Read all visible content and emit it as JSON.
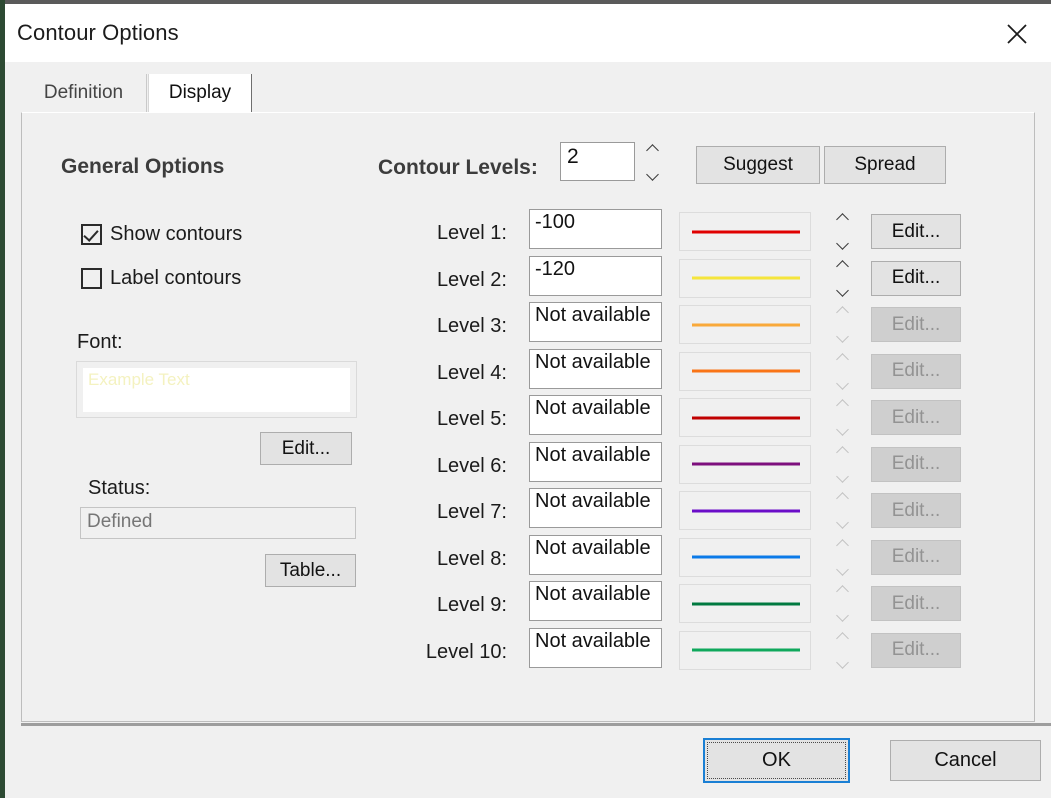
{
  "window": {
    "title": "Contour Options",
    "close_icon": "close-icon"
  },
  "tabs": [
    {
      "label": "Definition",
      "active": false
    },
    {
      "label": "Display",
      "active": true
    }
  ],
  "general_options": {
    "heading": "General Options",
    "checkboxes": [
      {
        "label": "Show contours",
        "checked": true
      },
      {
        "label": "Label contours",
        "checked": false
      }
    ],
    "font": {
      "label": "Font:",
      "preview_text": "Example Text",
      "preview_color": "#f4f2c0",
      "edit_label": "Edit..."
    },
    "status": {
      "label": "Status:",
      "value": "Defined",
      "table_label": "Table..."
    }
  },
  "contour_levels": {
    "label": "Contour Levels:",
    "count": "2",
    "suggest_label": "Suggest",
    "spread_label": "Spread",
    "edit_label": "Edit...",
    "rows": [
      {
        "label": "Level 1:",
        "value": "-100",
        "color": "#e00000",
        "enabled": true
      },
      {
        "label": "Level 2:",
        "value": "-120",
        "color": "#f5e53c",
        "enabled": true
      },
      {
        "label": "Level 3:",
        "value": "Not available",
        "color": "#f9a93a",
        "enabled": false
      },
      {
        "label": "Level 4:",
        "value": "Not available",
        "color": "#f97416",
        "enabled": false
      },
      {
        "label": "Level 5:",
        "value": "Not available",
        "color": "#c00000",
        "enabled": false
      },
      {
        "label": "Level 6:",
        "value": "Not available",
        "color": "#7d0f7d",
        "enabled": false
      },
      {
        "label": "Level 7:",
        "value": "Not available",
        "color": "#6a0dc8",
        "enabled": false
      },
      {
        "label": "Level 8:",
        "value": "Not available",
        "color": "#0b7ae8",
        "enabled": false
      },
      {
        "label": "Level 9:",
        "value": "Not available",
        "color": "#00793f",
        "enabled": false
      },
      {
        "label": "Level 10:",
        "value": "Not available",
        "color": "#0fa85c",
        "enabled": false
      }
    ]
  },
  "footer": {
    "ok_label": "OK",
    "cancel_label": "Cancel"
  },
  "colors": {
    "window_background": "#f0f0f0",
    "titlebar_background": "#ffffff",
    "focus_accent": "#1a7fd4"
  }
}
